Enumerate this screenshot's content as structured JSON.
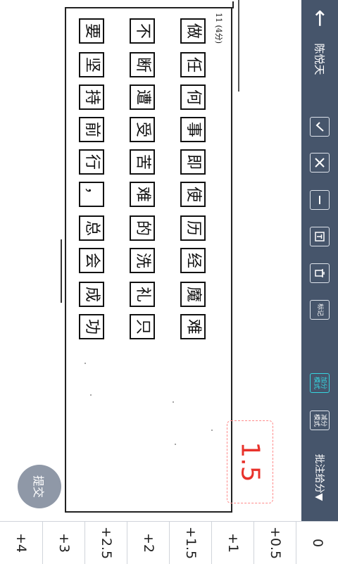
{
  "sidebar": {
    "student_name": "陈悦天",
    "tools": [
      {
        "icon": "check-icon"
      },
      {
        "icon": "cross-icon"
      },
      {
        "icon": "minus-icon"
      },
      {
        "icon": "text-icon"
      },
      {
        "icon": "trash-icon"
      }
    ],
    "mark_label": "标记",
    "add_mode_label": "加分模式",
    "subtract_mode_label": "减分模式",
    "grading_label": "批注给分▼"
  },
  "question": {
    "label": "11 (4分)",
    "rows": [
      [
        "做",
        "任",
        "何",
        "事",
        "即",
        "使",
        "历",
        "经",
        "魔",
        "难"
      ],
      [
        "不",
        "断",
        "遭",
        "受",
        "苦",
        "难",
        "的",
        "洗",
        "礼",
        "只"
      ],
      [
        "要",
        "坚",
        "持",
        "前",
        "行",
        "，",
        "总",
        "会",
        "成",
        "功"
      ]
    ]
  },
  "score": {
    "current": "1.5",
    "options": [
      "+4",
      "+3",
      "+2.5",
      "+2",
      "+1.5",
      "+1",
      "+0.5",
      "0"
    ]
  },
  "submit_label": "提交",
  "colors": {
    "sidebar_bg": "#46556b",
    "score_red": "#e8322b",
    "add_mode_accent": "#36d6e0"
  }
}
